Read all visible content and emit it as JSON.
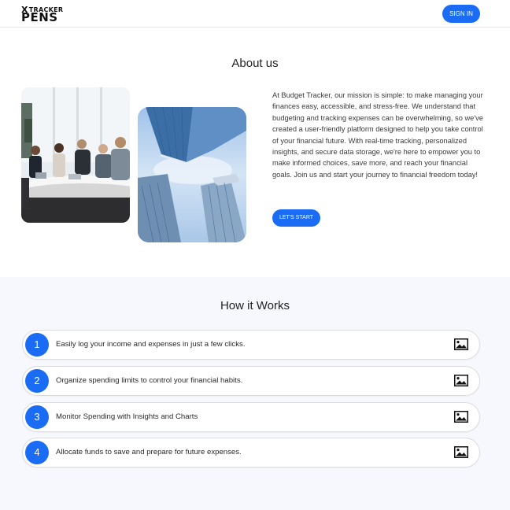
{
  "header": {
    "logo_top": "TRACKER",
    "logo_x": "X",
    "logo_bottom": "PENS",
    "signin_label": "SIGN IN"
  },
  "about": {
    "title": "About us",
    "paragraph": "At Budget Tracker, our mission is simple: to make managing your finances easy, accessible, and stress-free. We understand that budgeting and tracking expenses can be overwhelming, so we've created a user-friendly platform designed to help you take control of your financial future. With real-time tracking, personalized insights, and secure data storage, we're here to empower you to make informed choices, save more, and reach your financial goals. Join us and start your journey to financial freedom today!",
    "cta_label": "LET'S START"
  },
  "how": {
    "title": "How it Works",
    "steps": [
      {
        "num": "1",
        "text": "Easily log your income and expenses in just a few clicks.",
        "icon": "image-icon"
      },
      {
        "num": "2",
        "text": "Organize spending limits to control your financial habits.",
        "icon": "image-icon"
      },
      {
        "num": "3",
        "text": "Monitor Spending with Insights and Charts",
        "icon": "image-icon"
      },
      {
        "num": "4",
        "text": "Allocate funds to save and prepare for future expenses.",
        "icon": "image-icon"
      }
    ]
  },
  "colors": {
    "accent": "#1a6cf4",
    "section_bg": "#f6f8fd"
  }
}
